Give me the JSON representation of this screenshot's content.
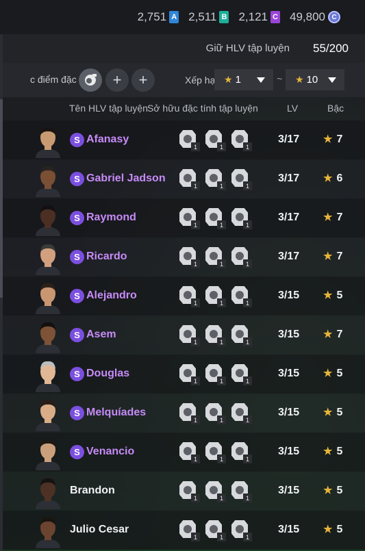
{
  "currencies": [
    {
      "value": "2,751",
      "badge": "A",
      "color": "#2f86d9"
    },
    {
      "value": "2,511",
      "badge": "B",
      "color": "#1fae9a"
    },
    {
      "value": "2,121",
      "badge": "C",
      "color": "#9b45d8"
    },
    {
      "value": "49,800",
      "badge": "C",
      "color": "#6a78d6"
    }
  ],
  "hold": {
    "label": "Giữ HLV tập luyện",
    "value": "55/200"
  },
  "filter": {
    "label": "c điểm đặc",
    "add_symbol": "+",
    "sort_label": "Xếp hạ",
    "tilde": "~",
    "from_value": "1",
    "to_value": "10",
    "star": "★"
  },
  "columns": {
    "name": "Tên HLV tập luyện",
    "traits": "Sở hữu đặc tính tập luyện",
    "lv": "LV",
    "grade": "Bậc"
  },
  "s_badge": "S",
  "trait_level": "1",
  "coaches": [
    {
      "name": "Afanasy",
      "special": true,
      "lv": "3/17",
      "grade": "7"
    },
    {
      "name": "Gabriel Jadson",
      "special": true,
      "lv": "3/17",
      "grade": "6"
    },
    {
      "name": "Raymond",
      "special": true,
      "lv": "3/17",
      "grade": "7"
    },
    {
      "name": "Ricardo",
      "special": true,
      "lv": "3/17",
      "grade": "7"
    },
    {
      "name": "Alejandro",
      "special": true,
      "lv": "3/15",
      "grade": "5"
    },
    {
      "name": "Asem",
      "special": true,
      "lv": "3/15",
      "grade": "7"
    },
    {
      "name": "Douglas",
      "special": true,
      "lv": "3/15",
      "grade": "5"
    },
    {
      "name": "Melquíades",
      "special": true,
      "lv": "3/15",
      "grade": "5"
    },
    {
      "name": "Venancio",
      "special": true,
      "lv": "3/15",
      "grade": "5"
    },
    {
      "name": "Brandon",
      "special": false,
      "lv": "3/15",
      "grade": "5"
    },
    {
      "name": "Julio Cesar",
      "special": false,
      "lv": "3/15",
      "grade": "5"
    }
  ]
}
